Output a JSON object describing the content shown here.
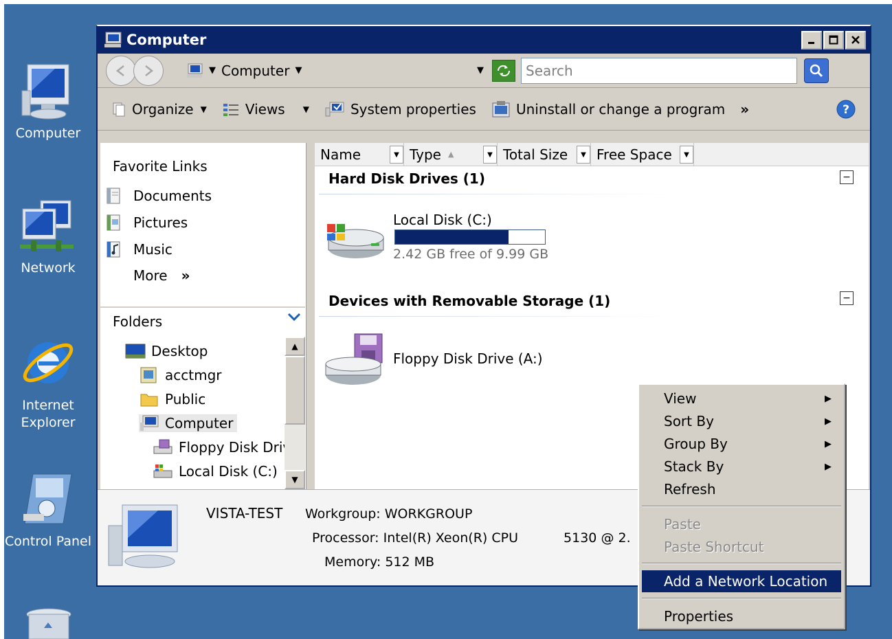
{
  "desktop": {
    "icons": [
      {
        "label": "Computer"
      },
      {
        "label": "Network"
      },
      {
        "label": "Internet Explorer"
      },
      {
        "label": "Control Panel"
      }
    ]
  },
  "window": {
    "title": "Computer",
    "address": "Computer",
    "search_placeholder": "Search"
  },
  "toolbar": {
    "organize": "Organize",
    "views": "Views",
    "system_properties": "System properties",
    "uninstall": "Uninstall or change a program",
    "more": "»"
  },
  "favorites": {
    "title": "Favorite Links",
    "items": [
      "Documents",
      "Pictures",
      "Music"
    ],
    "more": "More",
    "more_chevron": "»"
  },
  "folders": {
    "label": "Folders",
    "tree": [
      "Desktop",
      "acctmgr",
      "Public",
      "Computer",
      "Floppy Disk Drive",
      "Local Disk (C:)"
    ]
  },
  "columns": [
    "Name",
    "Type",
    "Total Size",
    "Free Space"
  ],
  "groups": {
    "hard_disks": {
      "title": "Hard Disk Drives (1)",
      "drive_label": "Local Disk (C:)",
      "free_text": "2.42 GB free of 9.99 GB",
      "used_fraction": 0.758
    },
    "removable": {
      "title": "Devices with Removable Storage (1)",
      "drive_label": "Floppy Disk Drive (A:)"
    }
  },
  "details": {
    "computer_name": "VISTA-TEST",
    "workgroup_key": "Workgroup:",
    "workgroup_val": "WORKGROUP",
    "processor_key": "Processor:",
    "processor_val": "Intel(R) Xeon(R) CPU",
    "processor_extra": "5130 @ 2.",
    "memory_key": "Memory:",
    "memory_val": "512 MB"
  },
  "context_menu": {
    "items": [
      {
        "label": "View",
        "has_submenu": true
      },
      {
        "label": "Sort By",
        "has_submenu": true
      },
      {
        "label": "Group By",
        "has_submenu": true
      },
      {
        "label": "Stack By",
        "has_submenu": true
      },
      {
        "label": "Refresh"
      },
      {
        "label": "Paste",
        "disabled": true
      },
      {
        "label": "Paste Shortcut",
        "disabled": true
      },
      {
        "label": "Add a Network Location",
        "highlighted": true
      },
      {
        "label": "Properties"
      }
    ]
  },
  "colors": {
    "desktop": "#3a6ea5",
    "titlebar": "#0a246a",
    "highlight": "#0a246a"
  }
}
